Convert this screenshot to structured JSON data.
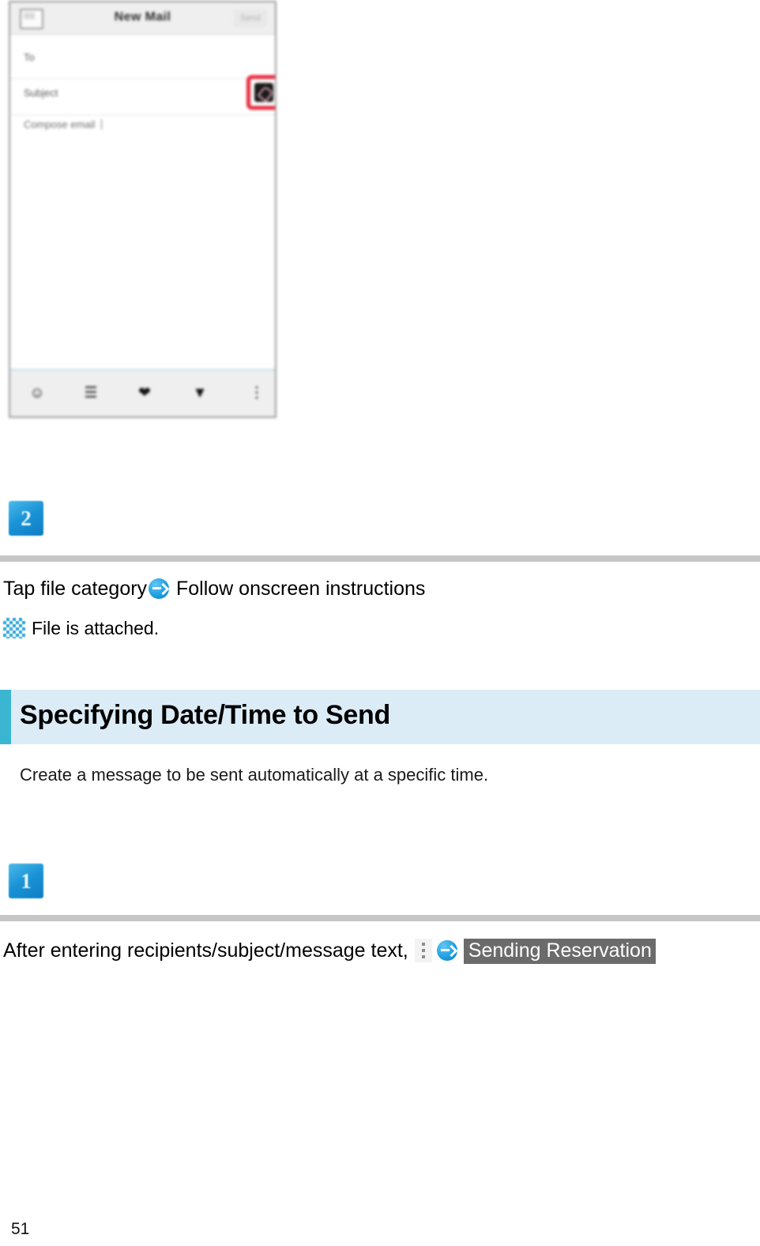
{
  "phone_screenshot": {
    "title": "New Mail",
    "back_icon": "back-mail-icon",
    "send_label": "Send",
    "fields": {
      "to": "To",
      "subject": "Subject",
      "body": "Compose email"
    },
    "attachment_highlight": {
      "icon": "attachment-image-icon",
      "highlight_color": "#e8283c"
    },
    "toolbar": [
      {
        "name": "emoji-icon",
        "glyph": "☺"
      },
      {
        "name": "attach-file-icon",
        "glyph": "☰"
      },
      {
        "name": "contacts-icon",
        "glyph": "❤"
      },
      {
        "name": "send-arrow-icon",
        "glyph": "▼"
      },
      {
        "name": "more-options-icon",
        "glyph": "⋮"
      }
    ]
  },
  "steps": {
    "step_two_badge": "2",
    "step_one_badge": "1"
  },
  "instructions": {
    "tap_file_category": "Tap file category",
    "follow_onscreen": "Follow onscreen instructions",
    "file_attached": "File is attached.",
    "after_entering": "After entering recipients/subject/message text,",
    "sending_reservation": "Sending Reservation"
  },
  "section": {
    "heading": "Specifying Date/Time to Send",
    "body": "Create a message to be sent automatically at a specific time.",
    "accent_color": "#3bb6d2",
    "background_color": "#dcecf7"
  },
  "footer": {
    "page_number": "51"
  }
}
